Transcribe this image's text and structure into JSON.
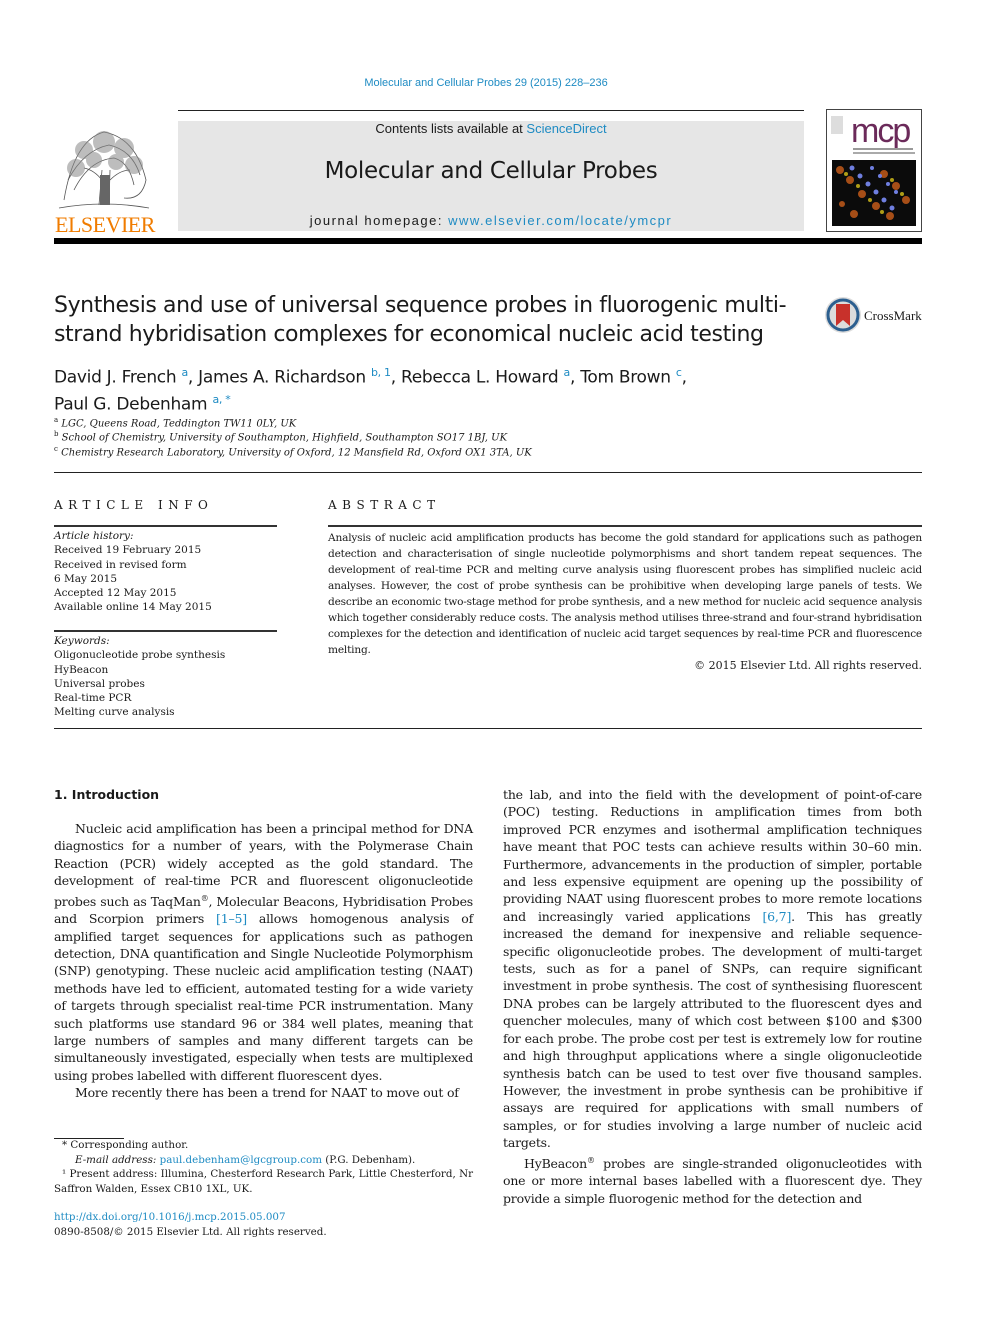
{
  "running_head": "Molecular and Cellular Probes 29 (2015) 228–236",
  "masthead": {
    "publisher_logo": "ELSEVIER",
    "contents_prefix": "Contents lists available at ",
    "contents_link": "ScienceDirect",
    "journal_title": "Molecular and Cellular Probes",
    "homepage_prefix": "journal homepage: ",
    "homepage_link": "www.elsevier.com/locate/ymcpr",
    "cover_abbrev": "mcp"
  },
  "article": {
    "title": "Synthesis and use of universal sequence probes in fluorogenic multi-strand hybridisation complexes for economical nucleic acid testing",
    "crossmark_label": "CrossMark",
    "authors": [
      {
        "name": "David J. French",
        "sup": "a",
        "sep": ", "
      },
      {
        "name": "James A. Richardson",
        "sup": "b, 1",
        "sep": ", "
      },
      {
        "name": "Rebecca L. Howard",
        "sup": "a",
        "sep": ", "
      },
      {
        "name": "Tom Brown",
        "sup": "c",
        "sep": ","
      },
      {
        "name": "Paul G. Debenham",
        "sup": "a, *",
        "sep": ""
      }
    ],
    "affiliations": [
      {
        "key": "a",
        "text": "LGC, Queens Road, Teddington TW11 0LY, UK"
      },
      {
        "key": "b",
        "text": "School of Chemistry, University of Southampton, Highfield, Southampton SO17 1BJ, UK"
      },
      {
        "key": "c",
        "text": "Chemistry Research Laboratory, University of Oxford, 12 Mansfield Rd, Oxford OX1 3TA, UK"
      }
    ]
  },
  "article_info": {
    "heading": "ARTICLE INFO",
    "history_label": "Article history:",
    "history": [
      "Received 19 February 2015",
      "Received in revised form",
      "6 May 2015",
      "Accepted 12 May 2015",
      "Available online 14 May 2015"
    ],
    "keywords_label": "Keywords:",
    "keywords": [
      "Oligonucleotide probe synthesis",
      "HyBeacon",
      "Universal probes",
      "Real-time PCR",
      "Melting curve analysis"
    ]
  },
  "abstract": {
    "heading": "ABSTRACT",
    "text": "Analysis of nucleic acid amplification products has become the gold standard for applications such as pathogen detection and characterisation of single nucleotide polymorphisms and short tandem repeat sequences. The development of real-time PCR and melting curve analysis using fluorescent probes has simplified nucleic acid analyses. However, the cost of probe synthesis can be prohibitive when developing large panels of tests. We describe an economic two-stage method for probe synthesis, and a new method for nucleic acid sequence analysis which together considerably reduce costs. The analysis method utilises three-strand and four-strand hybridisation complexes for the detection and identification of nucleic acid target sequences by real-time PCR and fluorescence melting.",
    "copyright": "© 2015 Elsevier Ltd. All rights reserved."
  },
  "body": {
    "section_heading": "1.  Introduction",
    "left_p1_a": "Nucleic acid amplification has been a principal method for DNA diagnostics for a number of years, with the Polymerase Chain Reaction (PCR) widely accepted as the gold standard. The development of real-time PCR and fluorescent oligonucleotide probes such as TaqMan",
    "left_p1_reg": "®",
    "left_p1_b": ", Molecular Beacons, Hybridisation Probes and Scorpion primers ",
    "left_p1_ref": "[1–5]",
    "left_p1_c": " allows homogenous analysis of amplified target sequences for applications such as pathogen detection, DNA quantification and Single Nucleotide Polymorphism (SNP) genotyping. These nucleic acid amplification testing (NAAT) methods have led to efficient, automated testing for a wide variety of targets through specialist real-time PCR instrumentation. Many such platforms use standard 96 or 384 well plates, meaning that large numbers of samples and many different targets can be simultaneously investigated, especially when tests are multiplexed using probes labelled with different fluorescent dyes.",
    "left_p2": "More recently there has been a trend for NAAT to move out of",
    "right_p1_a": "the lab, and into the field with the development of point-of-care (POC) testing. Reductions in amplification times from both improved PCR enzymes and isothermal amplification techniques have meant that POC tests can achieve results within 30–60 min. Furthermore, advancements in the production of simpler, portable and less expensive equipment are opening up the possibility of providing NAAT using fluorescent probes to more remote locations and increasingly varied applications ",
    "right_p1_ref": "[6,7]",
    "right_p1_b": ". This has greatly increased the demand for inexpensive and reliable sequence-specific oligonucleotide probes. The development of multi-target tests, such as for a panel of SNPs, can require significant investment in probe synthesis. The cost of synthesising fluorescent DNA probes can be largely attributed to the fluorescent dyes and quencher molecules, many of which cost between $100 and $300 for each probe. The probe cost per test is extremely low for routine and high throughput applications where a single oligonucleotide synthesis batch can be used to test over five thousand samples. However, the investment in probe synthesis can be prohibitive if assays are required for applications with small numbers of samples, or for studies involving a large number of nucleic acid targets.",
    "right_p2_a": "HyBeacon",
    "right_p2_reg": "®",
    "right_p2_b": " probes are single-stranded oligonucleotides with one or more internal bases labelled with a fluorescent dye. They provide a simple fluorogenic method for the detection and"
  },
  "footnotes": {
    "corresponding": "* Corresponding author.",
    "email_label": "E-mail address: ",
    "email": "paul.debenham@lgcgroup.com",
    "email_suffix": " (P.G. Debenham).",
    "present_address": "¹ Present address: Illumina, Chesterford Research Park, Little Chesterford, Nr Saffron Walden, Essex CB10 1XL, UK."
  },
  "doi": {
    "link": "http://dx.doi.org/10.1016/j.mcp.2015.05.007",
    "issn_line": "0890-8508/© 2015 Elsevier Ltd. All rights reserved."
  },
  "colors": {
    "link": "#1e8bc3",
    "elsevier_orange": "#f07c00",
    "banner_bg": "#e6e6e6"
  }
}
